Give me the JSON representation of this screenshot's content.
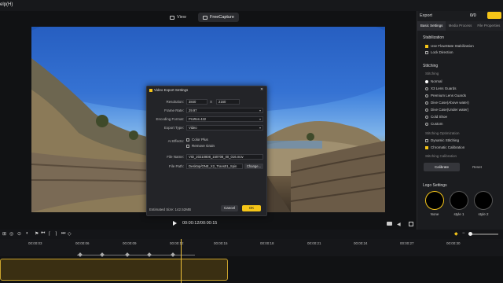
{
  "menu": {
    "help": "elp(H)"
  },
  "view_tabs": {
    "view": "View",
    "freecapture": "FreeCapture"
  },
  "player": {
    "time": "00:00:12/00:00:15"
  },
  "timeline": {
    "ticks": [
      "00:00:03",
      "00:00:06",
      "00:00:09",
      "00:00:12",
      "00:00:15",
      "00:00:18",
      "00:00:21",
      "00:00:24",
      "00:00:27",
      "00:00:30"
    ]
  },
  "export_panel": {
    "label": "Export",
    "count": "0/0",
    "tabs": [
      "Basic Settings",
      "Media Process",
      "File Properties"
    ],
    "stabilization": {
      "title": "Stabilization",
      "options": [
        {
          "label": "Use FlowState Stabilization",
          "checked": true
        },
        {
          "label": "Lock Direction",
          "checked": false
        }
      ]
    },
    "stitching": {
      "title": "Stitching",
      "subtitle": "Stitching",
      "options": [
        {
          "label": "Normal",
          "selected": true
        },
        {
          "label": "X3 Lens Guards",
          "selected": false
        },
        {
          "label": "Premium Lens Guards",
          "selected": false
        },
        {
          "label": "Dive Case(Above water)",
          "selected": false
        },
        {
          "label": "Dive Case(Under water)",
          "selected": false
        },
        {
          "label": "Cold Shoe",
          "selected": false
        },
        {
          "label": "Custom",
          "selected": false
        }
      ],
      "optimization_title": "Stitching Optimization",
      "optimization": [
        {
          "label": "Dynamic Stitching",
          "checked": false
        },
        {
          "label": "Chromatic Calibration",
          "checked": true
        }
      ],
      "calibration_title": "Stitching Calibration",
      "calibrate_btn": "Calibrate",
      "reset_btn": "Reset"
    },
    "logo": {
      "title": "Logo Settings",
      "items": [
        "None",
        "style 1",
        "style 2"
      ]
    }
  },
  "dialog": {
    "title": "Video Export Settings",
    "resolution_label": "Resolution:",
    "res_w": "3840",
    "res_x": "X",
    "res_h": "2160",
    "frame_rate_label": "Frame Rate:",
    "frame_rate": "29.97",
    "encoding_label": "Encoding Format:",
    "encoding": "ProRes 422",
    "export_type_label": "Export Type:",
    "export_type": "Video",
    "ai_effects_label": "AI Effects:",
    "ai_options": [
      {
        "label": "Color Plus",
        "checked": false
      },
      {
        "label": "Remove Grain",
        "checked": false
      }
    ],
    "file_name_label": "File Name:",
    "file_name": "VID_20210808_150708_00_016.mov",
    "file_path_label": "File Path:",
    "file_path": "Desktop/ONE_X2_Trans01_Spin",
    "change_btn": "Change...",
    "estimated_size": "Estimated Size: 142.52MB",
    "cancel_btn": "Cancel",
    "ok_btn": "OK"
  }
}
